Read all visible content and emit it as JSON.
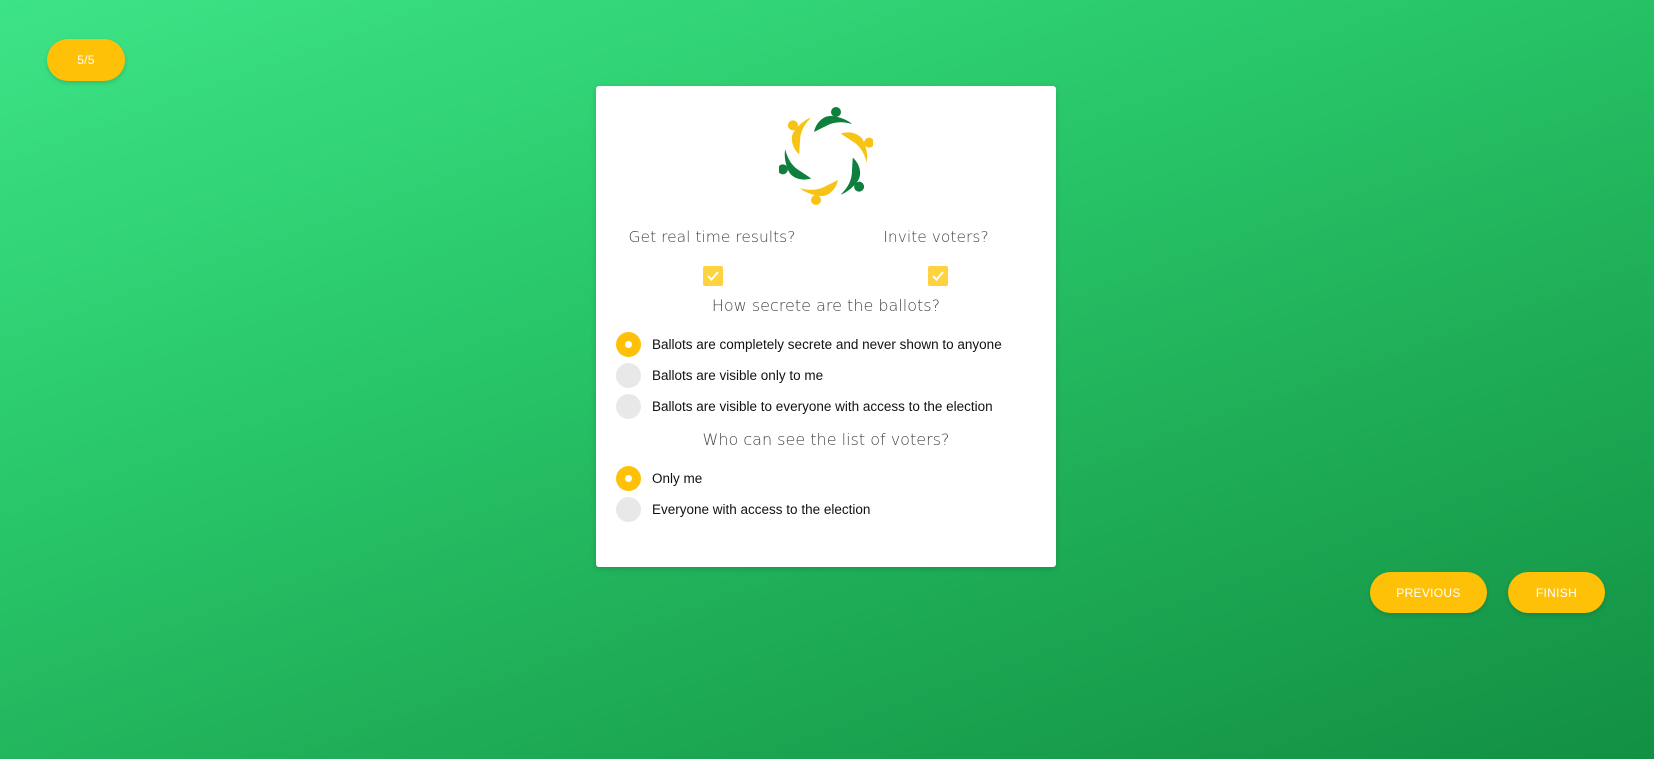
{
  "progress": {
    "label": "5/5"
  },
  "card": {
    "logo": "voting-people-circle-logo",
    "realtime": {
      "question": "Get real time results?",
      "checked": true
    },
    "invite": {
      "question": "Invite voters?",
      "checked": true
    },
    "secrecy": {
      "question": "How secrete are the ballots?",
      "selected": 0,
      "options": [
        "Ballots are completely secrete and never shown to anyone",
        "Ballots are visible only to me",
        "Ballots are visible to everyone with access to the election"
      ]
    },
    "voters_list": {
      "question": "Who can see the list of voters?",
      "selected": 0,
      "options": [
        "Only me",
        "Everyone with access to the election"
      ]
    }
  },
  "nav": {
    "previous_label": "PREVIOUS",
    "finish_label": "FINISH"
  },
  "colors": {
    "accent": "#ffc107",
    "checkbox": "#ffd23f",
    "logo_green": "#0f7f3e",
    "logo_yellow": "#f7c315"
  }
}
